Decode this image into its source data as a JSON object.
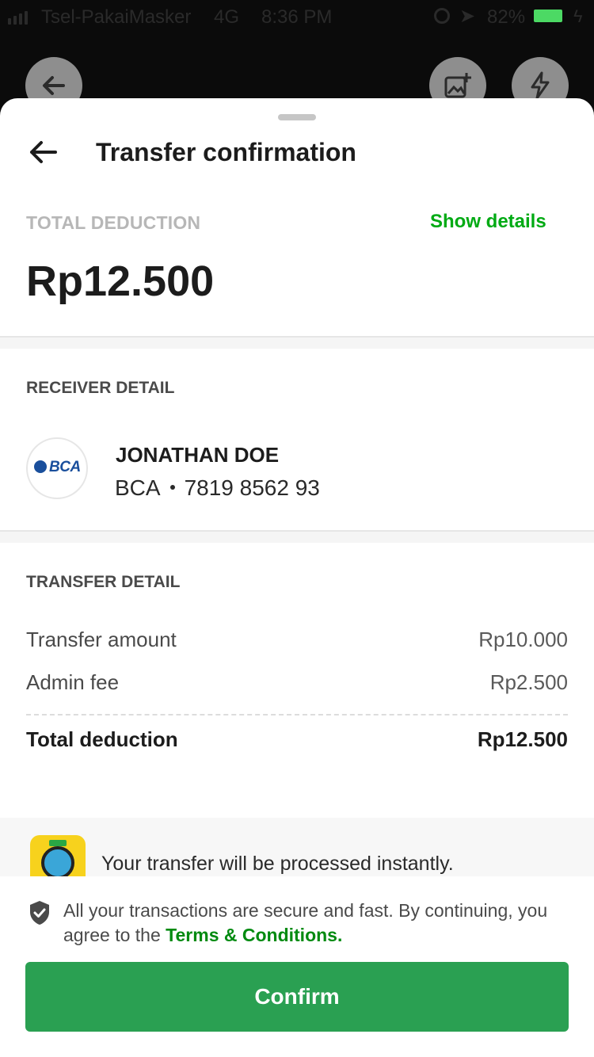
{
  "status_bar": {
    "carrier": "Tsel-PakaiMasker",
    "network": "4G",
    "time": "8:36 PM",
    "battery": "82%"
  },
  "camera_controls": {
    "icons": [
      "back-arrow-icon",
      "add-photo-icon",
      "flash-icon"
    ]
  },
  "sheet": {
    "title": "Transfer confirmation",
    "total_label": "TOTAL DEDUCTION",
    "show_details": "Show details",
    "total_amount": "Rp12.500"
  },
  "receiver": {
    "section_title": "RECEIVER DETAIL",
    "bank_logo_text": "BCA",
    "name": "JONATHAN DOE",
    "bank": "BCA",
    "account_number": "7819 8562 93"
  },
  "transfer": {
    "section_title": "TRANSFER DETAIL",
    "rows": [
      {
        "label": "Transfer amount",
        "value": "Rp10.000"
      },
      {
        "label": "Admin fee",
        "value": "Rp2.500"
      }
    ],
    "total": {
      "label": "Total deduction",
      "value": "Rp12.500"
    }
  },
  "instant_note": "Your transfer will be processed instantly.",
  "footer": {
    "secure_text": "All your transactions are secure and fast. By continuing, you agree to the ",
    "terms_link": "Terms & Conditions.",
    "confirm_label": "Confirm"
  },
  "colors": {
    "brand_green": "#00aa13",
    "confirm_button": "#2aa052",
    "bca_blue": "#1a4f9c"
  }
}
